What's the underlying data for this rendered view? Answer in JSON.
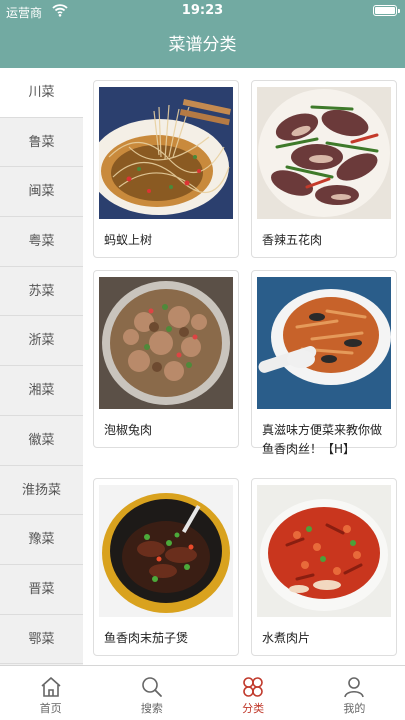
{
  "status_bar": {
    "carrier": "运营商",
    "time": "19:23"
  },
  "nav": {
    "title": "菜谱分类"
  },
  "sidebar": {
    "items": [
      {
        "label": "川菜"
      },
      {
        "label": "鲁菜"
      },
      {
        "label": "闽菜"
      },
      {
        "label": "粤菜"
      },
      {
        "label": "苏菜"
      },
      {
        "label": "浙菜"
      },
      {
        "label": "湘菜"
      },
      {
        "label": "徽菜"
      },
      {
        "label": "淮扬菜"
      },
      {
        "label": "豫菜"
      },
      {
        "label": "晋菜"
      },
      {
        "label": "鄂菜"
      }
    ],
    "active_index": 0
  },
  "recipes": [
    {
      "title": "蚂蚁上树"
    },
    {
      "title": "香辣五花肉"
    },
    {
      "title": "泡椒兔肉"
    },
    {
      "title": "真滋味方便菜来教你做鱼香肉丝！【H】"
    },
    {
      "title": "鱼香肉末茄子煲"
    },
    {
      "title": "水煮肉片"
    }
  ],
  "tab_bar": {
    "items": [
      {
        "label": "首页",
        "icon": "home-icon"
      },
      {
        "label": "搜索",
        "icon": "search-icon"
      },
      {
        "label": "分类",
        "icon": "category-icon"
      },
      {
        "label": "我的",
        "icon": "user-icon"
      }
    ],
    "active_index": 2
  },
  "colors": {
    "theme": "#72aaa2",
    "active_tab": "#c0392b"
  }
}
